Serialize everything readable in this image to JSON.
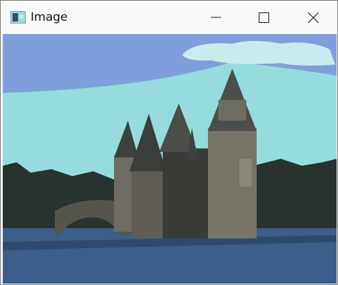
{
  "window": {
    "title": "Image",
    "icon": "image-icon"
  },
  "controls": {
    "minimize": "minimize-icon",
    "maximize": "maximize-icon",
    "close": "close-icon"
  },
  "colors": {
    "sky": "#7f9fdc",
    "sky_light": "#96dcdc",
    "trees": "#28322e",
    "water": "#3b5f8a",
    "stone": "#6e6c62"
  }
}
